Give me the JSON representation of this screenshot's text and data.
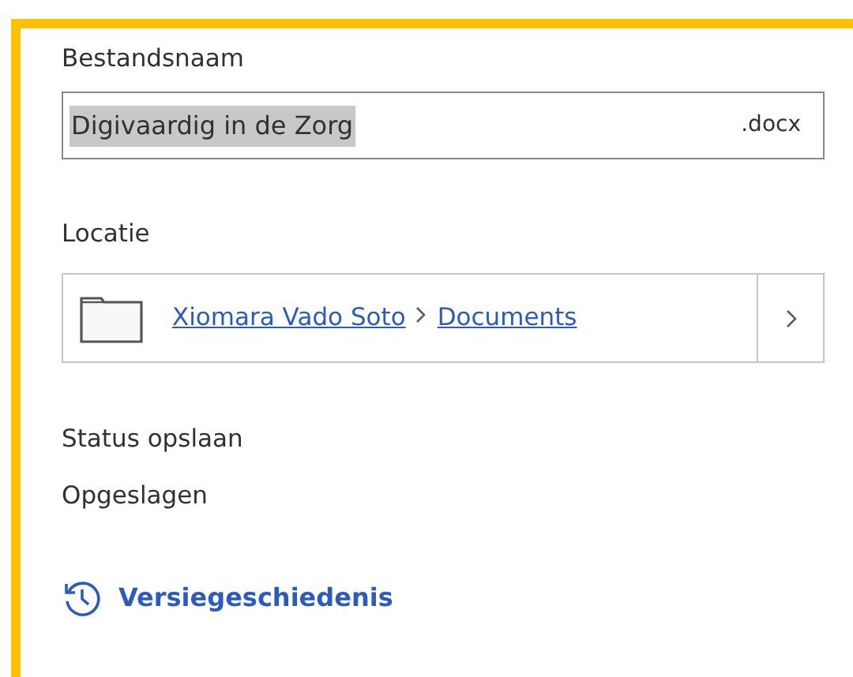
{
  "filename": {
    "label": "Bestandsnaam",
    "value": "Digivaardig in de Zorg",
    "value_selected": true,
    "extension": ".docx"
  },
  "location": {
    "label": "Locatie",
    "path": [
      {
        "text": "Xiomara Vado Soto"
      },
      {
        "text": "Documents"
      }
    ]
  },
  "save_status": {
    "label": "Status opslaan",
    "value": "Opgeslagen"
  },
  "version_history": {
    "text": "Versiegeschiedenis"
  }
}
